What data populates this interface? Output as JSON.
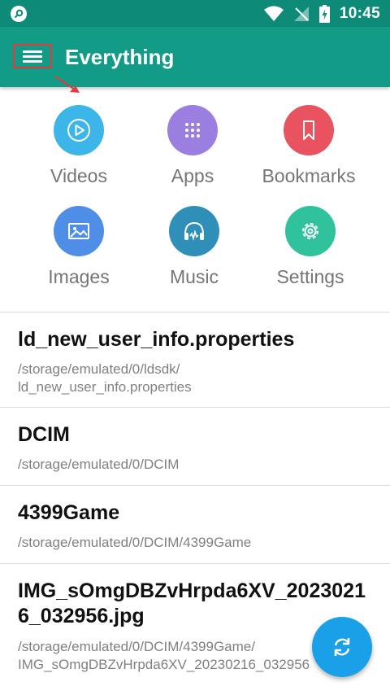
{
  "status_bar": {
    "time": "10:45"
  },
  "app_bar": {
    "title": "Everything"
  },
  "categories": [
    {
      "label": "Videos",
      "icon": "video-play-icon",
      "color": "#3cb5e8"
    },
    {
      "label": "Apps",
      "icon": "apps-grid-icon",
      "color": "#9b7fe0"
    },
    {
      "label": "Bookmarks",
      "icon": "bookmark-icon",
      "color": "#e9525f"
    },
    {
      "label": "Images",
      "icon": "image-icon",
      "color": "#4f8ee6"
    },
    {
      "label": "Music",
      "icon": "headphones-icon",
      "color": "#2f8fb8"
    },
    {
      "label": "Settings",
      "icon": "gear-icon",
      "color": "#2fc29c"
    }
  ],
  "files": [
    {
      "name": "ld_new_user_info.properties",
      "path_line1": "/storage/emulated/0/ldsdk/",
      "path_line2": "ld_new_user_info.properties"
    },
    {
      "name": "DCIM",
      "path_line1": "/storage/emulated/0/DCIM"
    },
    {
      "name": "4399Game",
      "path_line1": "/storage/emulated/0/DCIM/4399Game"
    },
    {
      "name_line1": "IMG_sOmgDBZvHrpda6XV_2023021",
      "name_line2": "6_032956.jpg",
      "path_line1": "/storage/emulated/0/DCIM/4399Game/",
      "path_line2": "IMG_sOmgDBZvHrpda6XV_20230216_032956"
    }
  ],
  "fab": {
    "icon": "refresh-icon",
    "color": "#1aa0e8"
  },
  "colors": {
    "status_bar": "#0e8a78",
    "app_bar": "#129b87",
    "highlight": "#e43a3a"
  }
}
